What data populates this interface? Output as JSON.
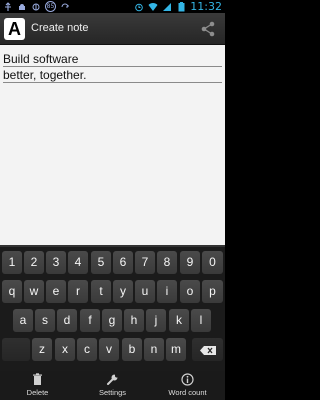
{
  "status_bar": {
    "notification_count": "85",
    "time": "11:32"
  },
  "action_bar": {
    "logo_letter": "A",
    "title": "Create note",
    "share_icon": "share-icon"
  },
  "note": {
    "lines": [
      "Build software",
      "better, together."
    ]
  },
  "keyboard": {
    "row_numbers": [
      "1",
      "2",
      "3",
      "4",
      "5",
      "6",
      "7",
      "8",
      "9",
      "0"
    ],
    "row_top": [
      "q",
      "w",
      "e",
      "r",
      "t",
      "y",
      "u",
      "i",
      "o",
      "p"
    ],
    "row_middle": [
      "a",
      "s",
      "d",
      "f",
      "g",
      "h",
      "j",
      "k",
      "l"
    ],
    "row_bottom": [
      "z",
      "x",
      "c",
      "v",
      "b",
      "n",
      "m"
    ],
    "backspace_icon": "backspace-icon"
  },
  "bottom_bar": {
    "items": [
      {
        "label": "Delete",
        "icon": "trash-icon"
      },
      {
        "label": "Settings",
        "icon": "wrench-icon"
      },
      {
        "label": "Word count",
        "icon": "info-icon"
      }
    ]
  }
}
